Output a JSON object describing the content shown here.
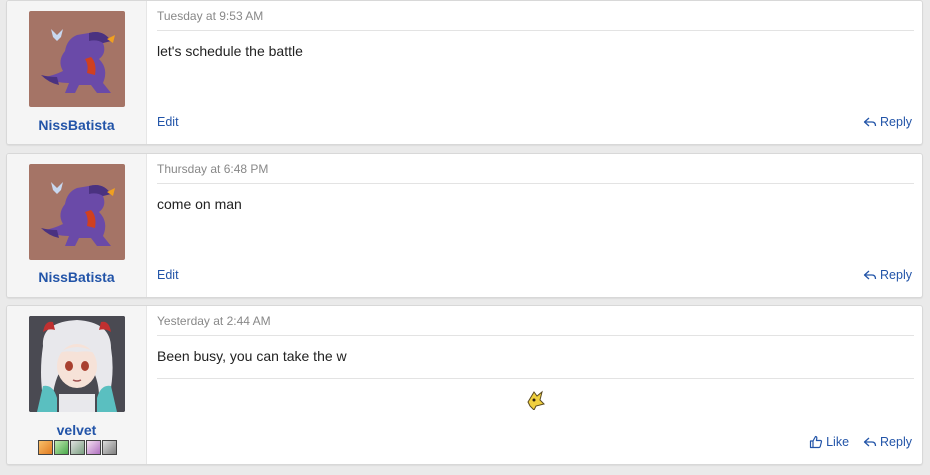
{
  "posts": [
    {
      "username": "NissBatista",
      "timestamp": "Tuesday at 9:53 AM",
      "message": "let's schedule the battle",
      "edit_label": "Edit",
      "reply_label": "Reply"
    },
    {
      "username": "NissBatista",
      "timestamp": "Thursday at 6:48 PM",
      "message": "come on man",
      "edit_label": "Edit",
      "reply_label": "Reply"
    },
    {
      "username": "velvet",
      "timestamp": "Yesterday at 2:44 AM",
      "message": "Been busy, you can take the w",
      "like_label": "Like",
      "reply_label": "Reply"
    }
  ],
  "colors": {
    "link": "#2254a8",
    "avatar_bg": "#a57466"
  }
}
